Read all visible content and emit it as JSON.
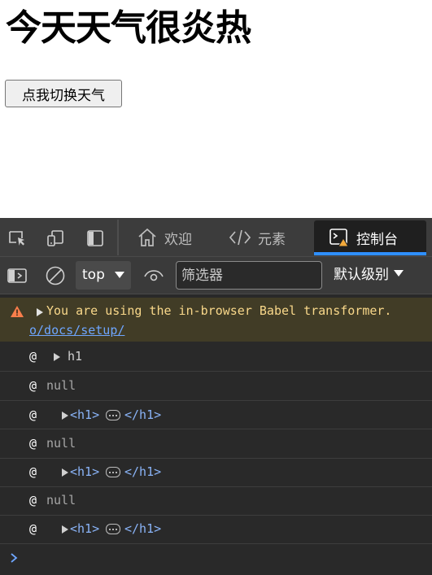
{
  "page": {
    "heading": "今天天气很炎热",
    "button_label": "点我切换天气"
  },
  "devtools": {
    "tabs": [
      {
        "label": "欢迎",
        "icon": "home-icon"
      },
      {
        "label": "元素",
        "icon": "code-icon"
      },
      {
        "label": "控制台",
        "icon": "console-icon",
        "active": true
      }
    ],
    "toolbar": {
      "context": "top",
      "filter_placeholder": "筛选器",
      "levels": "默认级别"
    },
    "console": {
      "warning": {
        "text": "You are using the in-browser Babel transformer.",
        "link": "o/docs/setup/"
      },
      "rows": [
        {
          "prefix": "@",
          "kind": "element-name",
          "text": "h1"
        },
        {
          "prefix": "@",
          "kind": "null",
          "text": "null"
        },
        {
          "prefix": "@",
          "kind": "element",
          "open": "<h1>",
          "close": "</h1>"
        },
        {
          "prefix": "@",
          "kind": "null",
          "text": "null"
        },
        {
          "prefix": "@",
          "kind": "element",
          "open": "<h1>",
          "close": "</h1>"
        },
        {
          "prefix": "@",
          "kind": "null",
          "text": "null"
        },
        {
          "prefix": "@",
          "kind": "element",
          "open": "<h1>",
          "close": "</h1>"
        }
      ]
    }
  },
  "colors": {
    "devtools_bg": "#292929",
    "warning_bg": "#413c26",
    "warning_text": "#f9d88a",
    "tag_color": "#8ab4f8",
    "accent": "#2f8fff"
  }
}
